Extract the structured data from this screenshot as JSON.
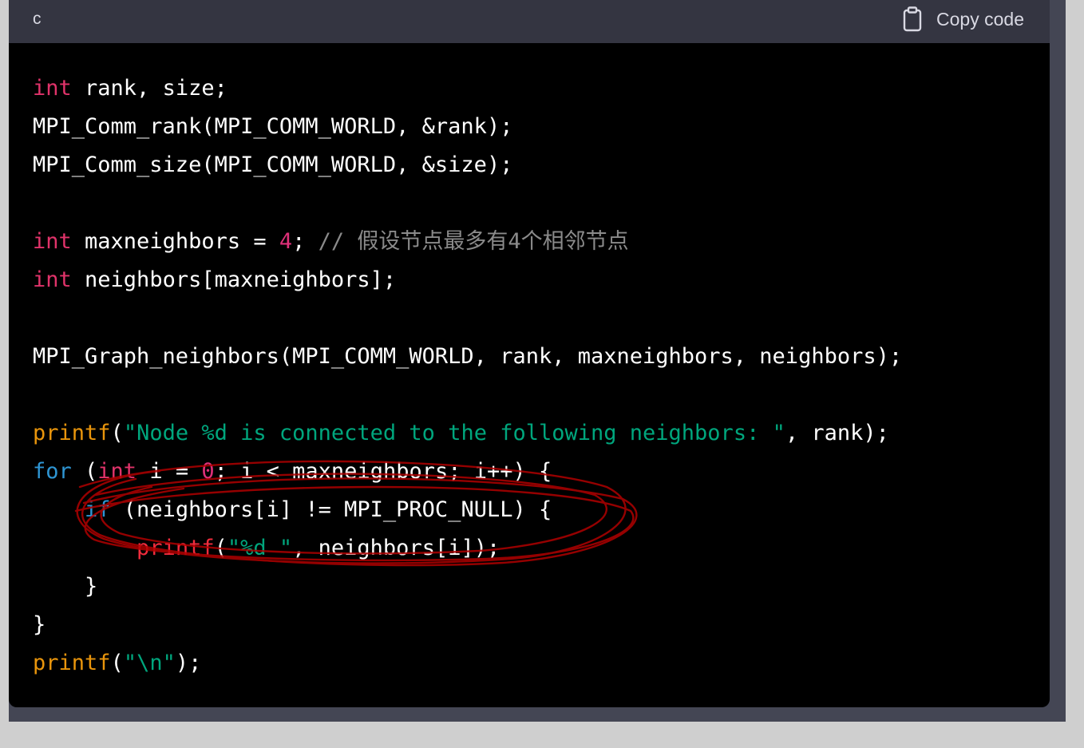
{
  "header": {
    "language": "c",
    "copy_label": "Copy code"
  },
  "code": {
    "lines": [
      [
        {
          "t": "int",
          "c": "kw"
        },
        {
          "t": " rank, size;",
          "c": ""
        }
      ],
      [
        {
          "t": "MPI_Comm_rank(MPI_COMM_WORLD, &rank);",
          "c": ""
        }
      ],
      [
        {
          "t": "MPI_Comm_size(MPI_COMM_WORLD, &size);",
          "c": ""
        }
      ],
      [],
      [
        {
          "t": "int",
          "c": "kw"
        },
        {
          "t": " maxneighbors = ",
          "c": ""
        },
        {
          "t": "4",
          "c": "num"
        },
        {
          "t": "; ",
          "c": ""
        },
        {
          "t": "// 假设节点最多有4个相邻节点",
          "c": "cmt"
        }
      ],
      [
        {
          "t": "int",
          "c": "kw"
        },
        {
          "t": " neighbors[maxneighbors];",
          "c": ""
        }
      ],
      [],
      [
        {
          "t": "MPI_Graph_neighbors(MPI_COMM_WORLD, rank, maxneighbors, neighbors);",
          "c": ""
        }
      ],
      [],
      [
        {
          "t": "printf",
          "c": "fn2"
        },
        {
          "t": "(",
          "c": ""
        },
        {
          "t": "\"Node %d is connected to the following neighbors: \"",
          "c": "str"
        },
        {
          "t": ", rank);",
          "c": ""
        }
      ],
      [
        {
          "t": "for",
          "c": "kw2"
        },
        {
          "t": " (",
          "c": ""
        },
        {
          "t": "int",
          "c": "kw"
        },
        {
          "t": " i = ",
          "c": ""
        },
        {
          "t": "0",
          "c": "num"
        },
        {
          "t": "; i < maxneighbors; i++) {",
          "c": ""
        }
      ],
      [
        {
          "t": "    ",
          "c": ""
        },
        {
          "t": "if",
          "c": "kw2"
        },
        {
          "t": " (neighbors[i] != MPI_PROC_NULL) {",
          "c": ""
        }
      ],
      [
        {
          "t": "        ",
          "c": ""
        },
        {
          "t": "printf",
          "c": "fn"
        },
        {
          "t": "(",
          "c": ""
        },
        {
          "t": "\"%d \"",
          "c": "str"
        },
        {
          "t": ", neighbors[i]);",
          "c": ""
        }
      ],
      [
        {
          "t": "    }",
          "c": ""
        }
      ],
      [
        {
          "t": "}",
          "c": ""
        }
      ],
      [
        {
          "t": "printf",
          "c": "fn2"
        },
        {
          "t": "(",
          "c": ""
        },
        {
          "t": "\"\\n\"",
          "c": "str"
        },
        {
          "t": ");",
          "c": ""
        }
      ]
    ]
  },
  "colors": {
    "keyword": "#e0336a",
    "control_keyword": "#2e95d3",
    "number": "#df3079",
    "string": "#00a67d",
    "function": "#e9950c",
    "comment": "#8a8a8a",
    "annotation_ink": "#b00000"
  },
  "icons": {
    "copy": "clipboard-icon"
  }
}
